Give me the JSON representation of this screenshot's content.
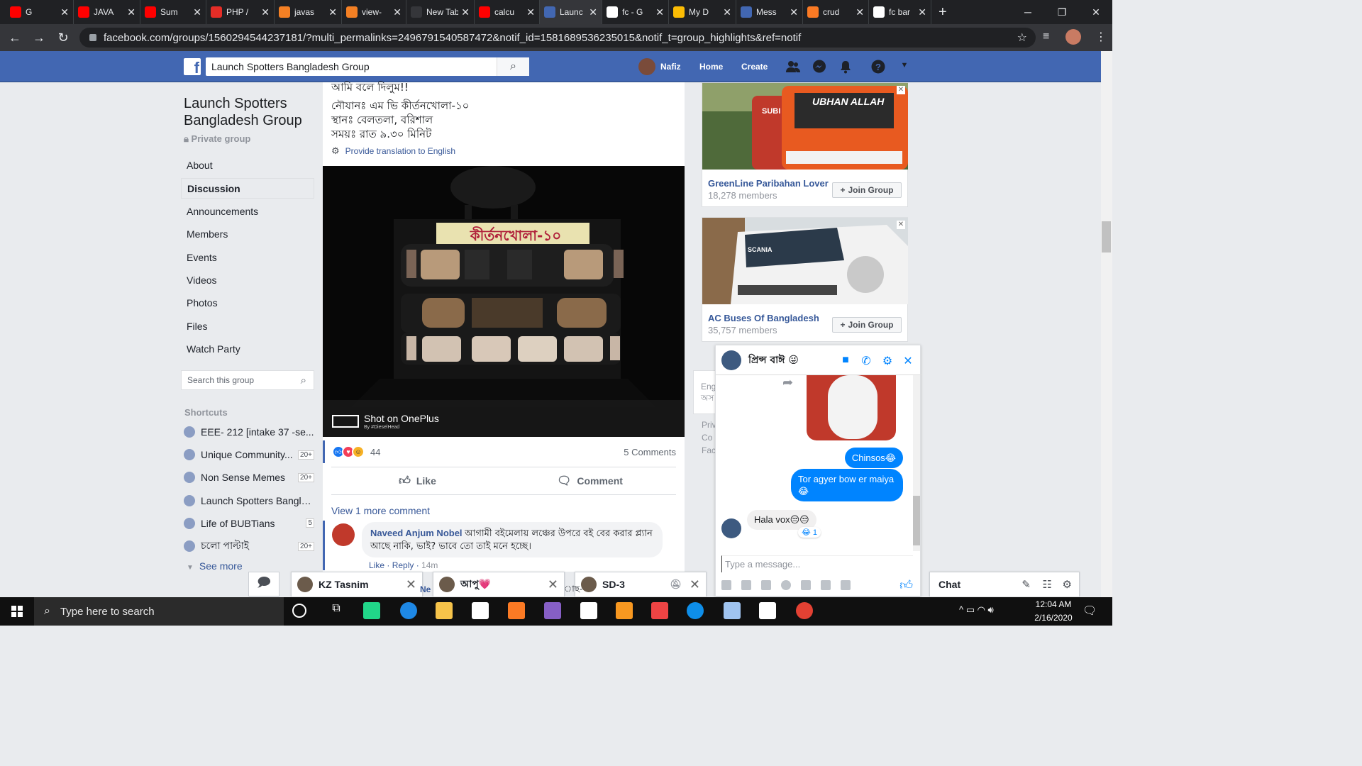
{
  "browser": {
    "tabs": [
      {
        "label": "G",
        "icon": "youtube-icon",
        "color": "#ff0000"
      },
      {
        "label": "JAVA",
        "icon": "youtube-icon",
        "color": "#ff0000"
      },
      {
        "label": "Sum",
        "icon": "youtube-icon",
        "color": "#ff0000"
      },
      {
        "label": "PHP /",
        "icon": "v-logo-icon",
        "color": "#e52d27"
      },
      {
        "label": "javas",
        "icon": "stackoverflow-icon",
        "color": "#f48024"
      },
      {
        "label": "view-",
        "icon": "stackoverflow-icon",
        "color": "#f48024"
      },
      {
        "label": "New Tab",
        "icon": "",
        "color": "#35363a"
      },
      {
        "label": "calcu",
        "icon": "youtube-icon",
        "color": "#ff0000"
      },
      {
        "label": "Launc",
        "icon": "facebook-icon",
        "color": "#4267b2"
      },
      {
        "label": "fc - G",
        "icon": "google-icon",
        "color": "#ffffff"
      },
      {
        "label": "My D",
        "icon": "drive-icon",
        "color": "#fbbc04"
      },
      {
        "label": "Mess",
        "icon": "facebook-icon",
        "color": "#4267b2"
      },
      {
        "label": "crud",
        "icon": "xampp-icon",
        "color": "#fb7a24"
      },
      {
        "label": "fc bar",
        "icon": "google-icon",
        "color": "#ffffff"
      }
    ],
    "active_tab_index": 8,
    "url": "facebook.com/groups/1560294544237181/?multi_permalinks=2496791540587472&notif_id=1581689536235015&notif_t=group_highlights&ref=notif"
  },
  "fb": {
    "search_value": "Launch Spotters Bangladesh Group",
    "profile_name": "Nafiz",
    "nav_home": "Home",
    "nav_create": "Create"
  },
  "left": {
    "group_title": "Launch Spotters Bangladesh Group",
    "privacy": "Private group",
    "nav": [
      "About",
      "Discussion",
      "Announcements",
      "Members",
      "Events",
      "Videos",
      "Photos",
      "Files",
      "Watch Party"
    ],
    "selected_nav_index": 1,
    "search_placeholder": "Search this group",
    "shortcuts_title": "Shortcuts",
    "shortcuts": [
      {
        "name": "EEE- 212 [intake 37 -se...",
        "badge": ""
      },
      {
        "name": "Unique Community...",
        "badge": "20+"
      },
      {
        "name": "Non Sense Memes",
        "badge": "20+"
      },
      {
        "name": "Launch Spotters Bangla...",
        "badge": ""
      },
      {
        "name": "Life of BUBTians",
        "badge": "5"
      },
      {
        "name": "চলো পাল্টাই",
        "badge": "20+"
      }
    ],
    "see_more": "See more"
  },
  "post": {
    "lines": [
      "আমি বলে দিলুম!!",
      "নৌযানঃ এম ভি কীর্তনখোলা-১০",
      "স্থানঃ বেলতলা, বরিশাল",
      "সময়ঃ রাত ৯.৩০ মিনিট"
    ],
    "translate": "Provide translation to English",
    "photo_sign": "কীর্তনখোলা-১০",
    "photo_watermark": "Shot on OnePlus",
    "photo_watermark_sub": "By #DieselHead",
    "reaction_count": "44",
    "comments_count": "5 Comments",
    "like": "Like",
    "comment": "Comment",
    "view_more": "View 1 more comment",
    "comment_author": "Naveed Anjum Nobel",
    "comment_text": "আগামী বইমেলায় লঞ্চের উপরে বই বের করার প্ল্যান আছে নাকি, ভাই? ভাবে তো তাই মনে হচ্ছে।",
    "comment_like": "Like",
    "comment_reply": "Reply",
    "comment_time": "14m"
  },
  "suggestions": [
    {
      "name": "GreenLine Paribahan Lover",
      "members": "18,278 members",
      "join": "Join Group",
      "bus_text": "UBHAN ALLAH",
      "bus_text2": "SUBI"
    },
    {
      "name": "AC Buses Of Bangladesh",
      "members": "35,757 members",
      "join": "Join Group",
      "bus_text": "SCANIA"
    }
  ],
  "right_misc": [
    "Eng",
    "অস",
    "Priv",
    "Co",
    "Fac"
  ],
  "messenger": {
    "name": "প্রিন্স বাঈ 😜",
    "msg1": "Chinsos😂",
    "msg2": "Tor agyer bow er maiya 😂",
    "incoming": "Hala vox😒😒",
    "incoming_reaction": "😂 1",
    "input_placeholder": "Type a message..."
  },
  "chat_tabs": [
    {
      "name": "KZ Tasnim"
    },
    {
      "name": "আপু💗"
    },
    {
      "name": "SD-3"
    }
  ],
  "chat_label": "Chat",
  "chat_peek_1": "Ne",
  "chat_peek_2": "াছ-",
  "taskbar": {
    "search_placeholder": "Type here to search",
    "time": "12:04 AM",
    "date": "2/16/2020"
  },
  "colors": {
    "fb_blue": "#4267b2",
    "messenger_blue": "#0084ff",
    "link": "#385898"
  }
}
